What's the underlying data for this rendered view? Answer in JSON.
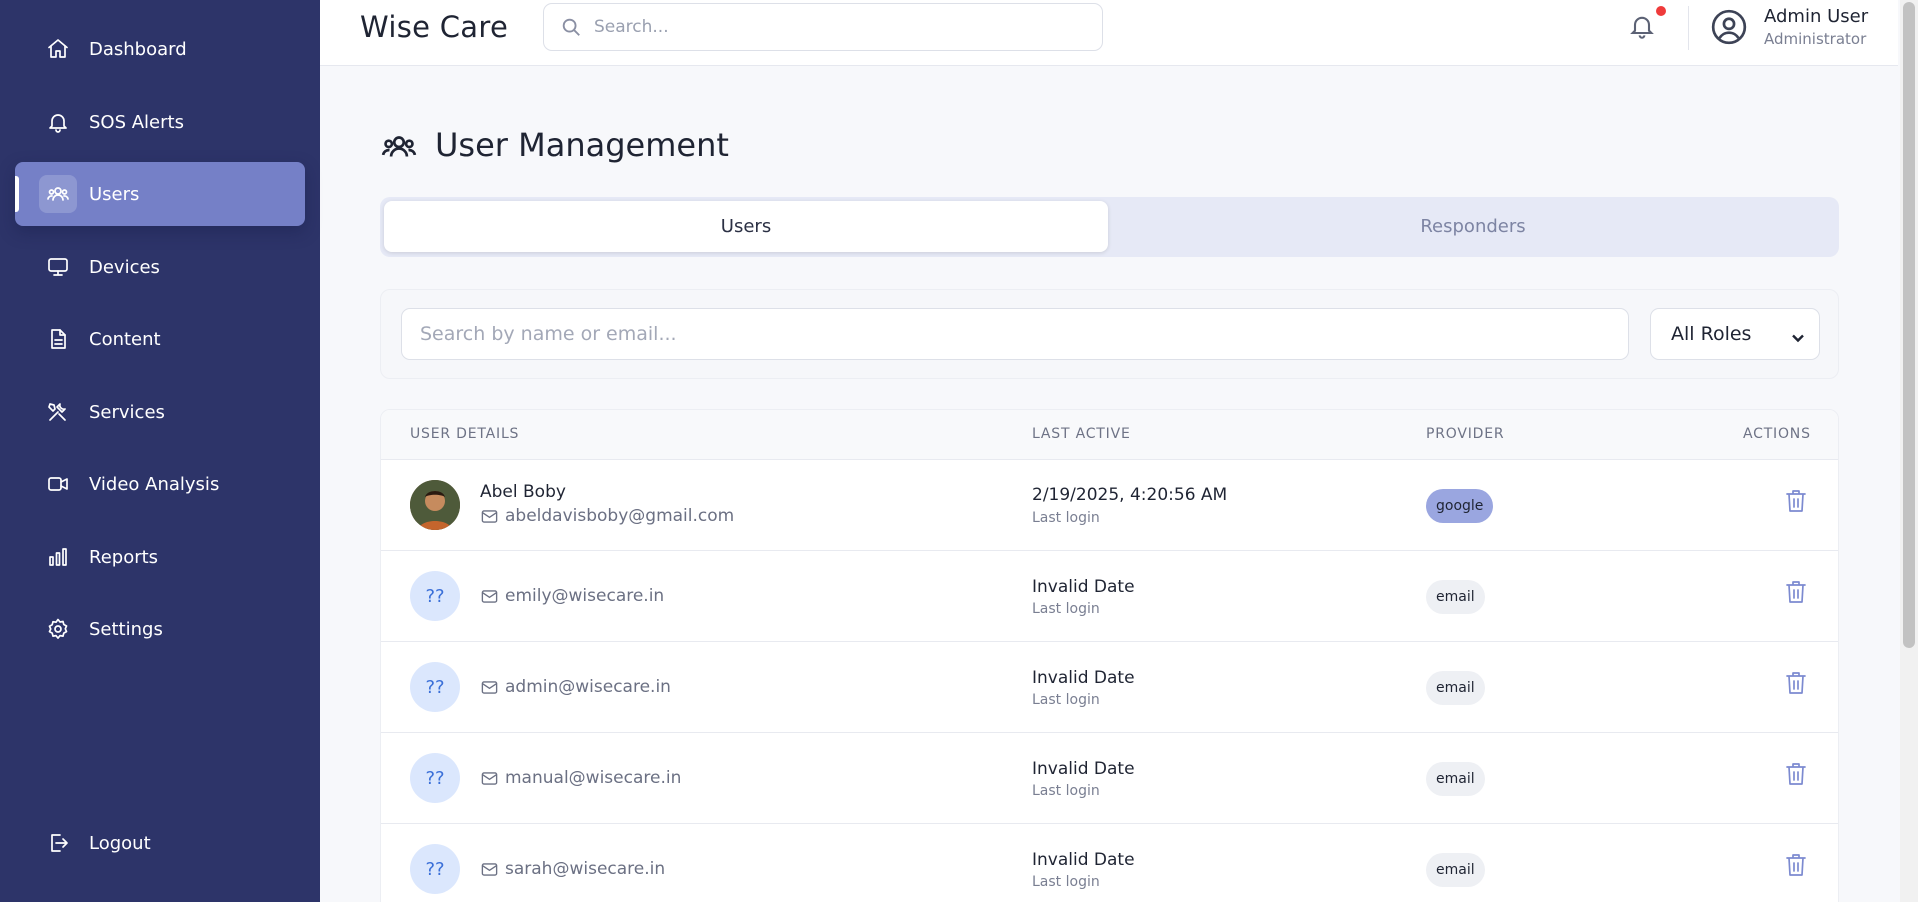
{
  "app": {
    "brand": "Wise Care"
  },
  "header": {
    "search_placeholder": "Search...",
    "notification_indicator": true,
    "user": {
      "name": "Admin User",
      "role": "Administrator"
    }
  },
  "sidebar": {
    "items": [
      {
        "label": "Dashboard",
        "icon": "home-icon",
        "active": false
      },
      {
        "label": "SOS Alerts",
        "icon": "bell-icon",
        "active": false
      },
      {
        "label": "Users",
        "icon": "users-icon",
        "active": true
      },
      {
        "label": "Devices",
        "icon": "monitor-icon",
        "active": false
      },
      {
        "label": "Content",
        "icon": "file-icon",
        "active": false
      },
      {
        "label": "Services",
        "icon": "tools-icon",
        "active": false
      },
      {
        "label": "Video Analysis",
        "icon": "video-icon",
        "active": false
      },
      {
        "label": "Reports",
        "icon": "bar-chart-icon",
        "active": false
      },
      {
        "label": "Settings",
        "icon": "gear-icon",
        "active": false
      }
    ],
    "logout": {
      "label": "Logout",
      "icon": "logout-icon"
    }
  },
  "main": {
    "title": "User Management",
    "tabs": [
      {
        "label": "Users",
        "active": true
      },
      {
        "label": "Responders",
        "active": false
      }
    ],
    "filter": {
      "search_placeholder": "Search by name or email...",
      "role_selected": "All Roles"
    },
    "table": {
      "columns": [
        "USER DETAILS",
        "LAST ACTIVE",
        "PROVIDER",
        "ACTIONS"
      ],
      "rows": [
        {
          "avatar": "photo",
          "name": "Abel Boby",
          "email": "abeldavisboby@gmail.com",
          "last_active": "2/19/2025, 4:20:56 AM",
          "last_active_sub": "Last login",
          "provider": "google"
        },
        {
          "avatar": "??",
          "name": "",
          "email": "emily@wisecare.in",
          "last_active": "Invalid Date",
          "last_active_sub": "Last login",
          "provider": "email"
        },
        {
          "avatar": "??",
          "name": "",
          "email": "admin@wisecare.in",
          "last_active": "Invalid Date",
          "last_active_sub": "Last login",
          "provider": "email"
        },
        {
          "avatar": "??",
          "name": "",
          "email": "manual@wisecare.in",
          "last_active": "Invalid Date",
          "last_active_sub": "Last login",
          "provider": "email"
        },
        {
          "avatar": "??",
          "name": "",
          "email": "sarah@wisecare.in",
          "last_active": "Invalid Date",
          "last_active_sub": "Last login",
          "provider": "email"
        }
      ]
    }
  },
  "colors": {
    "sidebar_bg": "#2d3469",
    "sidebar_active": "#7580c7",
    "tab_track": "#e6e9f6",
    "google_badge": "#9aa6e0",
    "email_badge": "#eef0f4",
    "notification_dot": "#ef3b3b"
  }
}
